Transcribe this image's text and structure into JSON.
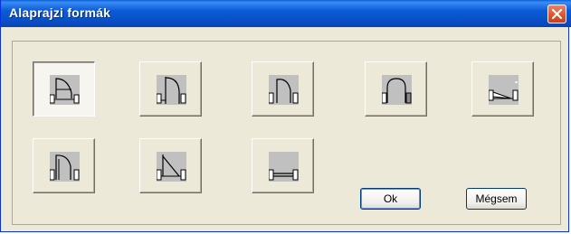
{
  "window": {
    "title": "Alaprajzi formák"
  },
  "shapes": [
    {
      "id": "shape-1",
      "icon": "door-arc-quarter-icon",
      "selected": true
    },
    {
      "id": "shape-2",
      "icon": "door-arc-tall-icon",
      "selected": false
    },
    {
      "id": "shape-3",
      "icon": "door-arc-offset-icon",
      "selected": false
    },
    {
      "id": "shape-4",
      "icon": "door-arc-round-icon",
      "selected": false
    },
    {
      "id": "shape-5",
      "icon": "door-sliding-icon",
      "selected": false
    },
    {
      "id": "shape-6",
      "icon": "door-arc-double-jamb-icon",
      "selected": false
    },
    {
      "id": "shape-7",
      "icon": "door-diagonal-icon",
      "selected": false
    },
    {
      "id": "shape-8",
      "icon": "opening-plain-icon",
      "selected": false
    }
  ],
  "buttons": {
    "ok": "Ok",
    "cancel": "Mégsem"
  }
}
